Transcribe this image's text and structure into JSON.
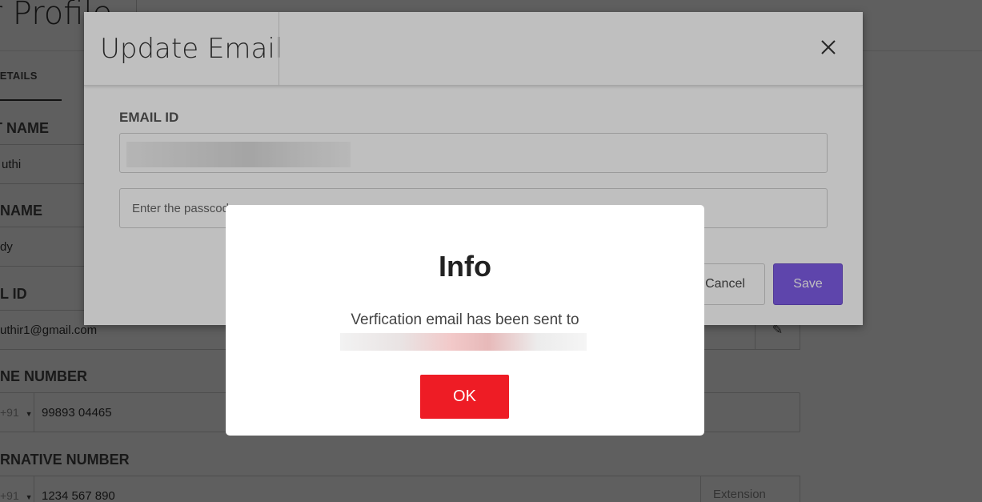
{
  "page": {
    "title": "er Profile",
    "tab_details": "DETAILS",
    "first_name_label": "T NAME",
    "first_name_value": "uthi",
    "last_name_label": "NAME",
    "last_name_value": "dy",
    "email_label": "L ID",
    "email_value": "uthir1@gmail.com",
    "phone_label": "NE NUMBER",
    "phone_country_code": "+91",
    "phone_value": "99893 04465",
    "alt_phone_label": "RNATIVE NUMBER",
    "alt_phone_country_code": "+91",
    "alt_phone_value": "1234 567 890",
    "extension_placeholder": "Extension"
  },
  "update_email_modal": {
    "title": "Update Email",
    "email_id_label": "EMAIL ID",
    "passcode_placeholder": "Enter the passcode",
    "cancel_label": "Cancel",
    "save_label": "Save"
  },
  "info_dialog": {
    "title": "Info",
    "message": "Verfication email has been sent to",
    "ok_label": "OK"
  },
  "colors": {
    "save_button": "#7e5ce6",
    "ok_button": "#ee1c25"
  }
}
